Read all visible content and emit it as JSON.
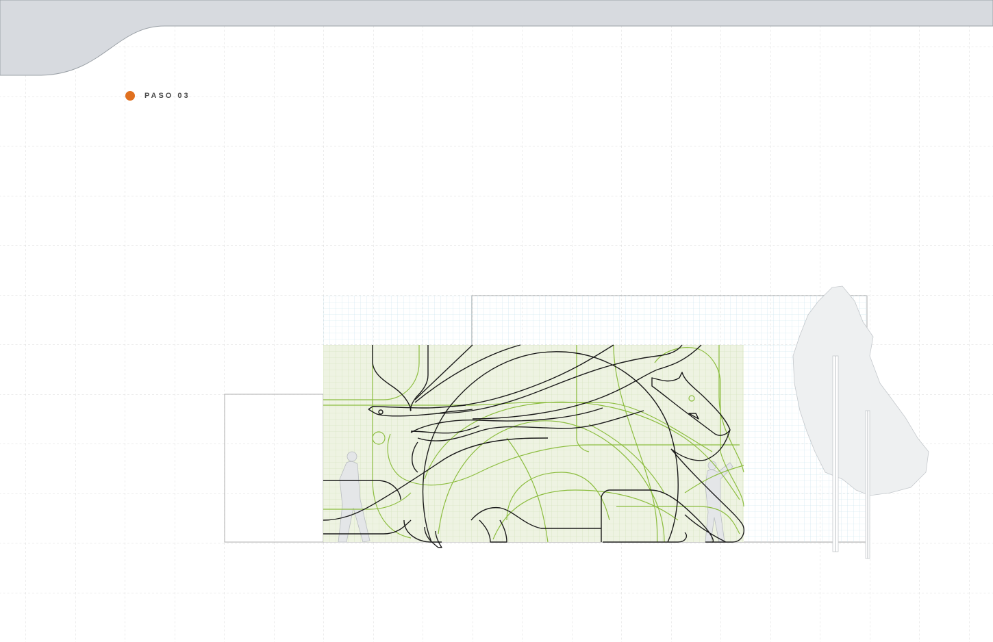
{
  "step": {
    "label": "PASO 03"
  },
  "colors": {
    "accent_dot": "#e0701f",
    "header_band": "#d7dadf",
    "page_grid": "#d9d9d9",
    "fine_grid": "#bfe0ea",
    "green_fill": "#eef3e2",
    "green_line": "#8cbd3f",
    "black_line": "#1a1a1a",
    "ghost": "#c9cdd1"
  },
  "icons": [
    "step-marker-icon",
    "jaguar-line-art-icon",
    "person-silhouette-icon",
    "tree-silhouette-icon"
  ]
}
